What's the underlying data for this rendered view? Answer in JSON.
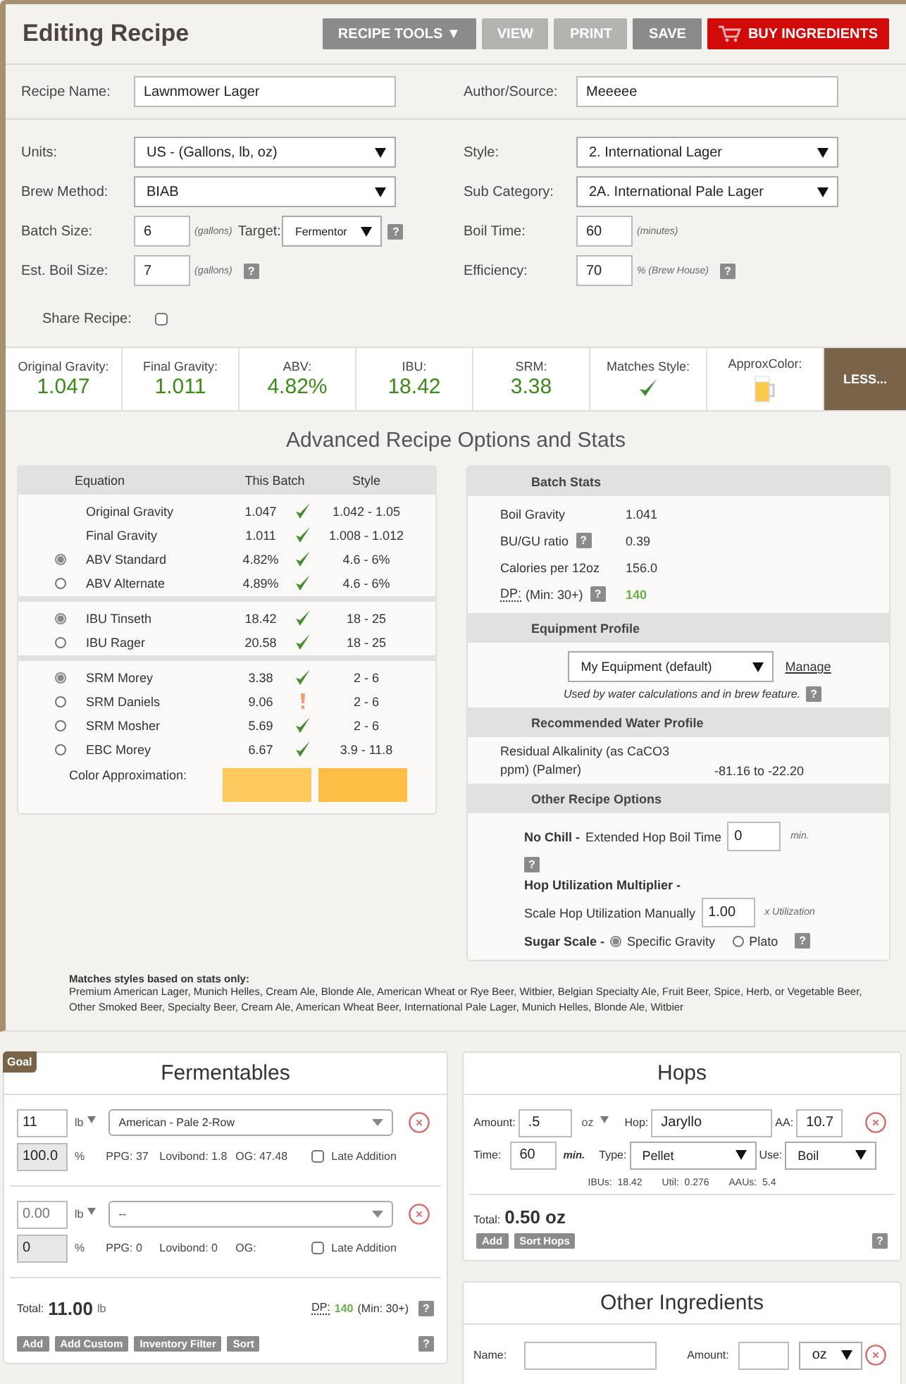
{
  "header": {
    "title": "Editing Recipe",
    "buttons": [
      {
        "label": "RECIPE TOOLS ▼",
        "kind": "plain",
        "disabled": false
      },
      {
        "label": "VIEW",
        "kind": "plain",
        "disabled": true
      },
      {
        "label": "PRINT",
        "kind": "plain",
        "disabled": true
      },
      {
        "label": "SAVE",
        "kind": "plain",
        "disabled": false
      },
      {
        "label": "BUY INGREDIENTS",
        "kind": "buy",
        "disabled": false
      }
    ]
  },
  "name_row": [
    {
      "label": "Recipe Name:",
      "value": "Lawnmower Lager"
    },
    {
      "label": "Author/Source:",
      "value": "Meeeee"
    }
  ],
  "settings": {
    "left": [
      {
        "kind": "select",
        "label": "Units:",
        "value": "US - (Gallons, lb, oz)"
      },
      {
        "kind": "select",
        "label": "Brew Method:",
        "value": "BIAB"
      },
      {
        "kind": "number",
        "label": "Batch Size:",
        "value": "6",
        "unit": "(gallons)",
        "target_label": "Target:",
        "target": "Fermentor",
        "help": "?"
      },
      {
        "kind": "number",
        "label": "Est. Boil Size:",
        "value": "7",
        "unit": "(gallons)",
        "help": "?"
      }
    ],
    "right": [
      {
        "kind": "select",
        "label": "Style:",
        "value": "2. International Lager"
      },
      {
        "kind": "select",
        "label": "Sub Category:",
        "value": "2A. International Pale Lager"
      },
      {
        "kind": "number",
        "label": "Boil Time:",
        "value": "60",
        "unit": "(minutes)"
      },
      {
        "kind": "number",
        "label": "Efficiency:",
        "value": "70",
        "unit": "% (Brew House)",
        "help": "?"
      }
    ]
  },
  "share": {
    "label": "Share Recipe:",
    "checked": false
  },
  "stats_bar": {
    "items": [
      {
        "kind": "value",
        "label": "Original Gravity:",
        "value": "1.047"
      },
      {
        "kind": "value",
        "label": "Final Gravity:",
        "value": "1.011"
      },
      {
        "kind": "value",
        "label": "ABV:",
        "value": "4.82%"
      },
      {
        "kind": "value",
        "label": "IBU:",
        "value": "18.42"
      },
      {
        "kind": "value",
        "label": "SRM:",
        "value": "3.38"
      },
      {
        "kind": "check",
        "label": "Matches Style:",
        "matched": true
      },
      {
        "kind": "color",
        "label": "ApproxColor:"
      }
    ],
    "toggle": "LESS..."
  },
  "advanced": {
    "title": "Advanced Recipe Options and Stats",
    "equations": {
      "columns": [
        "Equation",
        "This Batch",
        "Style"
      ],
      "groups": [
        {
          "rows": [
            {
              "kind": "plain",
              "name": "Original Gravity",
              "value": "1.047",
              "in_range": true,
              "style": "1.042 - 1.05"
            },
            {
              "kind": "plain",
              "name": "Final Gravity",
              "value": "1.011",
              "in_range": true,
              "style": "1.008 - 1.012"
            },
            {
              "kind": "radio",
              "selected": true,
              "name": "ABV Standard",
              "value": "4.82%",
              "in_range": true,
              "style": "4.6 - 6%"
            },
            {
              "kind": "radio",
              "selected": false,
              "name": "ABV Alternate",
              "value": "4.89%",
              "in_range": true,
              "style": "4.6 - 6%"
            }
          ]
        },
        {
          "rows": [
            {
              "kind": "radio",
              "selected": true,
              "name": "IBU Tinseth",
              "value": "18.42",
              "in_range": true,
              "style": "18 - 25"
            },
            {
              "kind": "radio",
              "selected": false,
              "name": "IBU Rager",
              "value": "20.58",
              "in_range": true,
              "style": "18 - 25"
            }
          ]
        },
        {
          "rows": [
            {
              "kind": "radio",
              "selected": true,
              "name": "SRM Morey",
              "value": "3.38",
              "in_range": true,
              "style": "2 - 6"
            },
            {
              "kind": "radio",
              "selected": false,
              "name": "SRM Daniels",
              "value": "9.06",
              "in_range": false,
              "style": "2 - 6"
            },
            {
              "kind": "radio",
              "selected": false,
              "name": "SRM Mosher",
              "value": "5.69",
              "in_range": true,
              "style": "2 - 6"
            },
            {
              "kind": "radio",
              "selected": false,
              "name": "EBC Morey",
              "value": "6.67",
              "in_range": true,
              "style": "3.9 - 11.8"
            }
          ]
        }
      ],
      "color_label": "Color Approximation:",
      "swatches": [
        {
          "color": "#fdc95c"
        },
        {
          "color": "#fdbe45"
        }
      ]
    },
    "batch_stats": {
      "title": "Batch Stats",
      "rows": [
        {
          "kind": "plain",
          "label": "Boil Gravity",
          "value": "1.041"
        },
        {
          "kind": "plain",
          "label": "BU/GU ratio",
          "help": "?",
          "value": "0.39"
        },
        {
          "kind": "plain",
          "label": "Calories per 12oz",
          "value": "156.0"
        },
        {
          "kind": "dp",
          "label": "DP:",
          "note": "(Min: 30+)",
          "help": "?",
          "value": "140"
        }
      ]
    },
    "equipment": {
      "title": "Equipment Profile",
      "value": "My Equipment (default)",
      "link": "Manage",
      "note": "Used by water calculations and in brew feature.",
      "help": "?"
    },
    "water": {
      "title": "Recommended Water Profile",
      "label": "Residual Alkalinity (as CaCO3 ppm) (Palmer)",
      "value": "-81.16 to -22.20"
    },
    "options": {
      "title": "Other Recipe Options",
      "no_chill": {
        "label": "No Chill -",
        "text": "Extended Hop Boil Time",
        "value": "0",
        "unit": "min.",
        "help": "?"
      },
      "hop_util": {
        "label": "Hop Utilization Multiplier -",
        "text": "Scale Hop Utilization Manually",
        "value": "1.00",
        "unit": "x Utilization"
      },
      "sugar": {
        "label": "Sugar Scale -",
        "options": [
          {
            "label": "Specific Gravity",
            "selected": true
          },
          {
            "label": "Plato",
            "selected": false
          }
        ],
        "help": "?"
      }
    }
  },
  "matches": {
    "title": "Matches styles based on stats only:",
    "text": "Premium American Lager, Munich Helles, Cream Ale, Blonde Ale, American Wheat or Rye Beer, Witbier, Belgian Specialty Ale, Fruit Beer, Spice, Herb, or Vegetable Beer, Other Smoked Beer, Specialty Beer, Cream Ale, American Wheat Beer, International Pale Lager, Munich Helles, Blonde Ale, Witbier"
  },
  "fermentables": {
    "badge": "Goal",
    "title": "Fermentables",
    "rows": [
      {
        "amount": "11",
        "unit": "lb",
        "name": "American - Pale 2-Row",
        "percent": "100.0",
        "percent_unit": "%",
        "ppg": "PPG: 37",
        "lovibond": "Lovibond: 1.8",
        "og": "OG: 47.48",
        "late_label": "Late Addition",
        "late": false
      },
      {
        "amount_placeholder": "0.00",
        "unit": "lb",
        "name": "--",
        "percent": "0",
        "percent_unit": "%",
        "ppg": "PPG: 0",
        "lovibond": "Lovibond: 0",
        "og": "OG:",
        "late_label": "Late Addition",
        "late": false
      }
    ],
    "total_label": "Total:",
    "total": "11.00",
    "total_unit": "lb",
    "dp_label": "DP:",
    "dp_value": "140",
    "dp_note": "(Min: 30+)",
    "dp_help": "?",
    "buttons": [
      "Add",
      "Add Custom",
      "Inventory Filter",
      "Sort"
    ],
    "help": "?"
  },
  "hops": {
    "title": "Hops",
    "rows": [
      {
        "amount_label": "Amount:",
        "amount": ".5",
        "unit": "oz",
        "hop_label": "Hop:",
        "hop": "Jaryllo",
        "aa_label": "AA:",
        "aa": "10.7",
        "time_label": "Time:",
        "time": "60",
        "time_unit": "min.",
        "type_label": "Type:",
        "type": "Pellet",
        "use_label": "Use:",
        "use": "Boil",
        "ibus": "IBUs:  18.42",
        "util": "Util:  0.276",
        "aaus": "AAUs:  5.4"
      }
    ],
    "total_label": "Total:",
    "total": "0.50 oz",
    "buttons": [
      "Add",
      "Sort Hops"
    ],
    "help": "?"
  },
  "other": {
    "title": "Other Ingredients",
    "name_label": "Name:",
    "amount_label": "Amount:",
    "unit": "oz"
  }
}
